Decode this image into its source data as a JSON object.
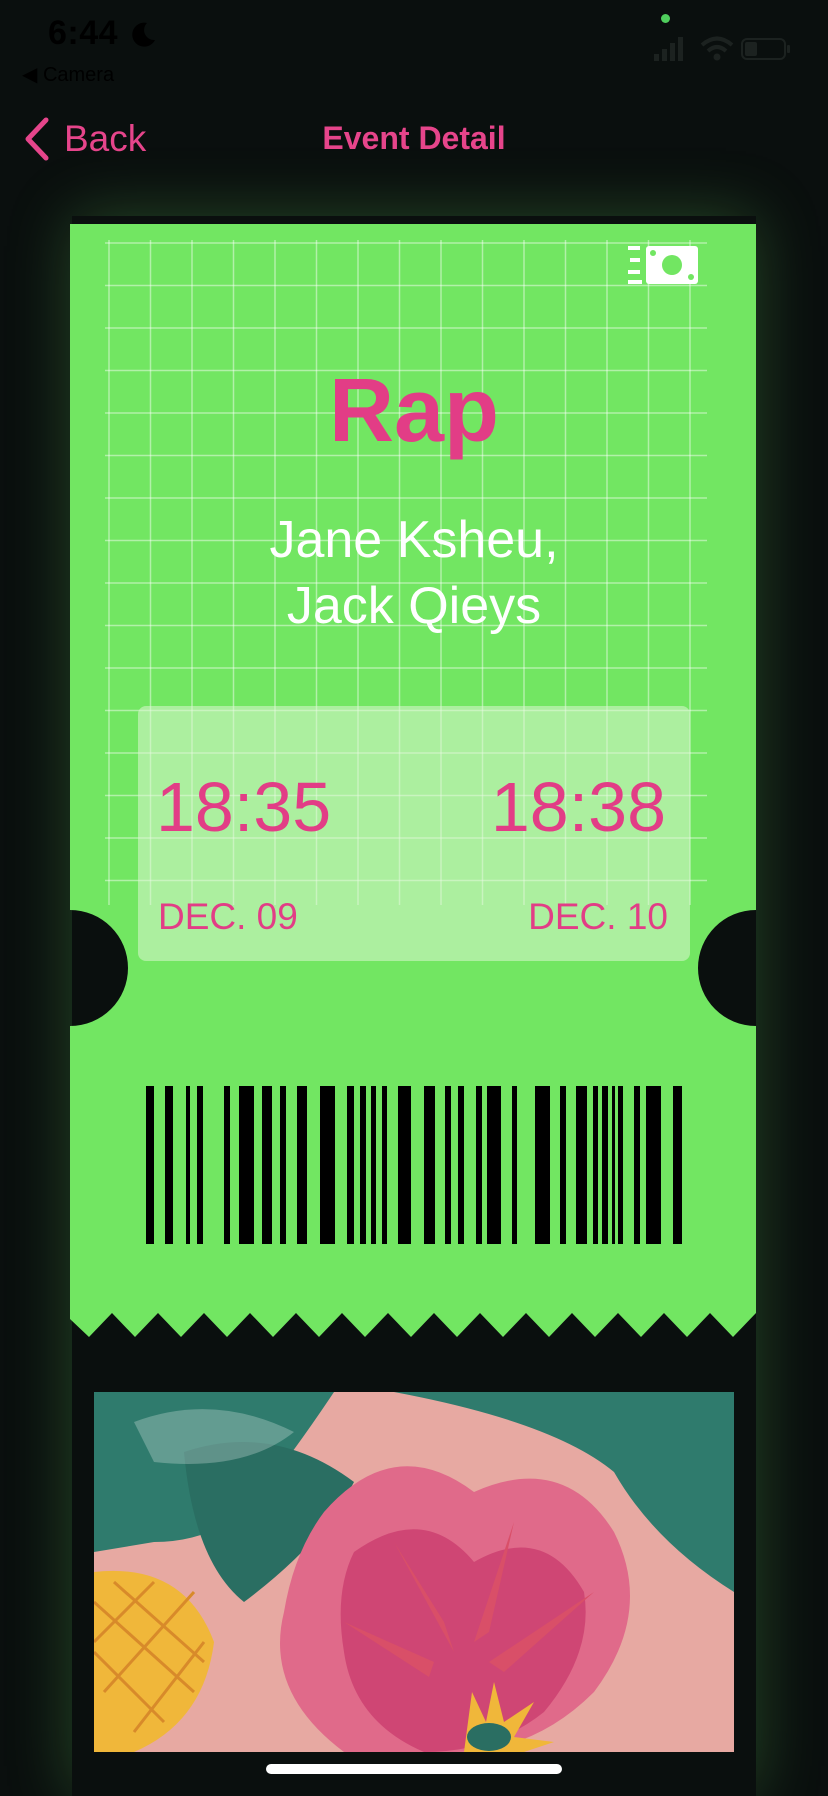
{
  "status_bar": {
    "time": "6:44",
    "back_app": "◀ Camera"
  },
  "nav": {
    "back_label": "Back",
    "title": "Event Detail"
  },
  "ticket": {
    "title": "Rap",
    "artists_line1": "Jane Ksheu,",
    "artists_line2": "Jack Qieys",
    "start_time": "18:35",
    "end_time": "18:38",
    "start_date": "DEC. 09",
    "end_date": "DEC. 10"
  },
  "colors": {
    "accent": "#e23d86",
    "ticket_green": "#72e662",
    "background": "#0a0f0e"
  },
  "icons": [
    "chevron-left-icon",
    "money-icon",
    "moon-icon",
    "signal-icon",
    "wifi-icon",
    "battery-icon"
  ]
}
